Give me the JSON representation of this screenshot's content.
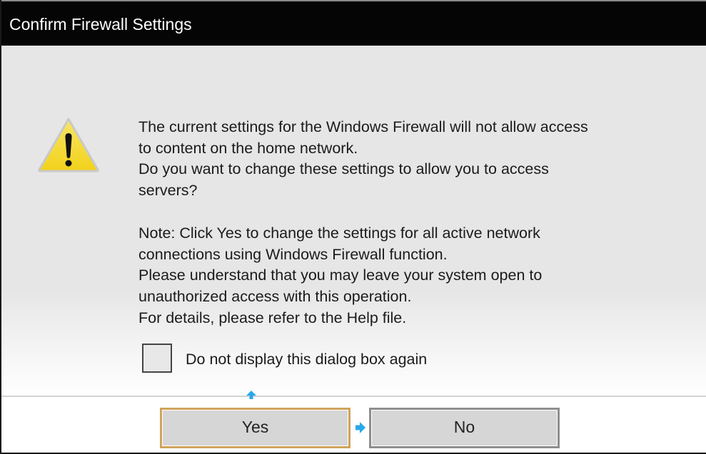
{
  "window": {
    "title": "Confirm Firewall Settings"
  },
  "icons": {
    "warning": "warning-triangle-icon",
    "focus_up": "arrow-up-icon",
    "focus_right": "arrow-right-icon"
  },
  "message": {
    "line1": "The current settings for the Windows Firewall will not allow access",
    "line2": "to content on the home network.",
    "line3": "Do you want to change these settings to allow you to access",
    "line4": "servers?",
    "note1": "Note: Click Yes to change the settings for all active network",
    "note2": "connections using Windows Firewall function.",
    "note3": "Please understand that you may leave your system open to",
    "note4": "unauthorized access with this operation.",
    "note5": "For details, please refer to the Help file."
  },
  "checkbox": {
    "label": "Do not display this dialog box again",
    "checked": false
  },
  "buttons": {
    "yes": "Yes",
    "no": "No"
  },
  "colors": {
    "titlebar": "#050505",
    "focus_border": "#cfa45c",
    "focus_arrow": "#29a8e8",
    "warning_fill": "#f3d81f"
  }
}
